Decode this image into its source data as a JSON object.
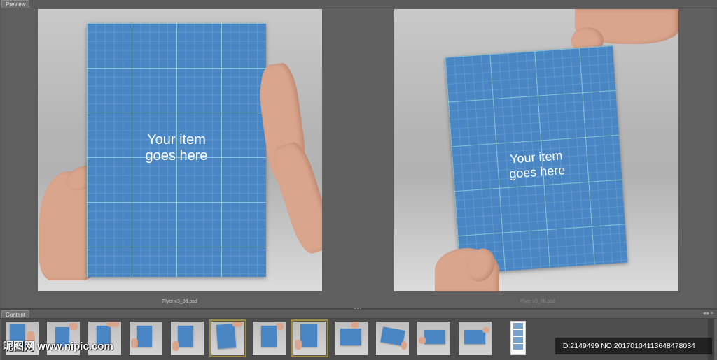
{
  "panels": {
    "preview_label": "Preview",
    "content_label": "Content",
    "content_toolbar": "◂ ▸ ≡"
  },
  "preview": {
    "left": {
      "filename": "Flyer v3_08.psd",
      "flyer_line1": "Your item",
      "flyer_line2": "goes here"
    },
    "right": {
      "filename": "Flyer v3_06.psd",
      "flyer_line1": "Your item",
      "flyer_line2": "goes here"
    }
  },
  "thumbnails": [
    {
      "variant": "a",
      "selected": false
    },
    {
      "variant": "b",
      "selected": false
    },
    {
      "variant": "c",
      "selected": false
    },
    {
      "variant": "d",
      "selected": false
    },
    {
      "variant": "e",
      "selected": false
    },
    {
      "variant": "f",
      "selected": true
    },
    {
      "variant": "g",
      "selected": false
    },
    {
      "variant": "h",
      "selected": true
    },
    {
      "variant": "i",
      "selected": false
    },
    {
      "variant": "j",
      "selected": false
    },
    {
      "variant": "k",
      "selected": false
    },
    {
      "variant": "l",
      "selected": false
    }
  ],
  "watermark": {
    "site": "昵图网 www.nipic.com",
    "id_text": "ID:2149499 NO:20170104113648478034"
  },
  "colors": {
    "flyer_blue": "#4a86c4",
    "selected_border": "#9b8a4a",
    "panel_background": "#5b5b5b"
  }
}
